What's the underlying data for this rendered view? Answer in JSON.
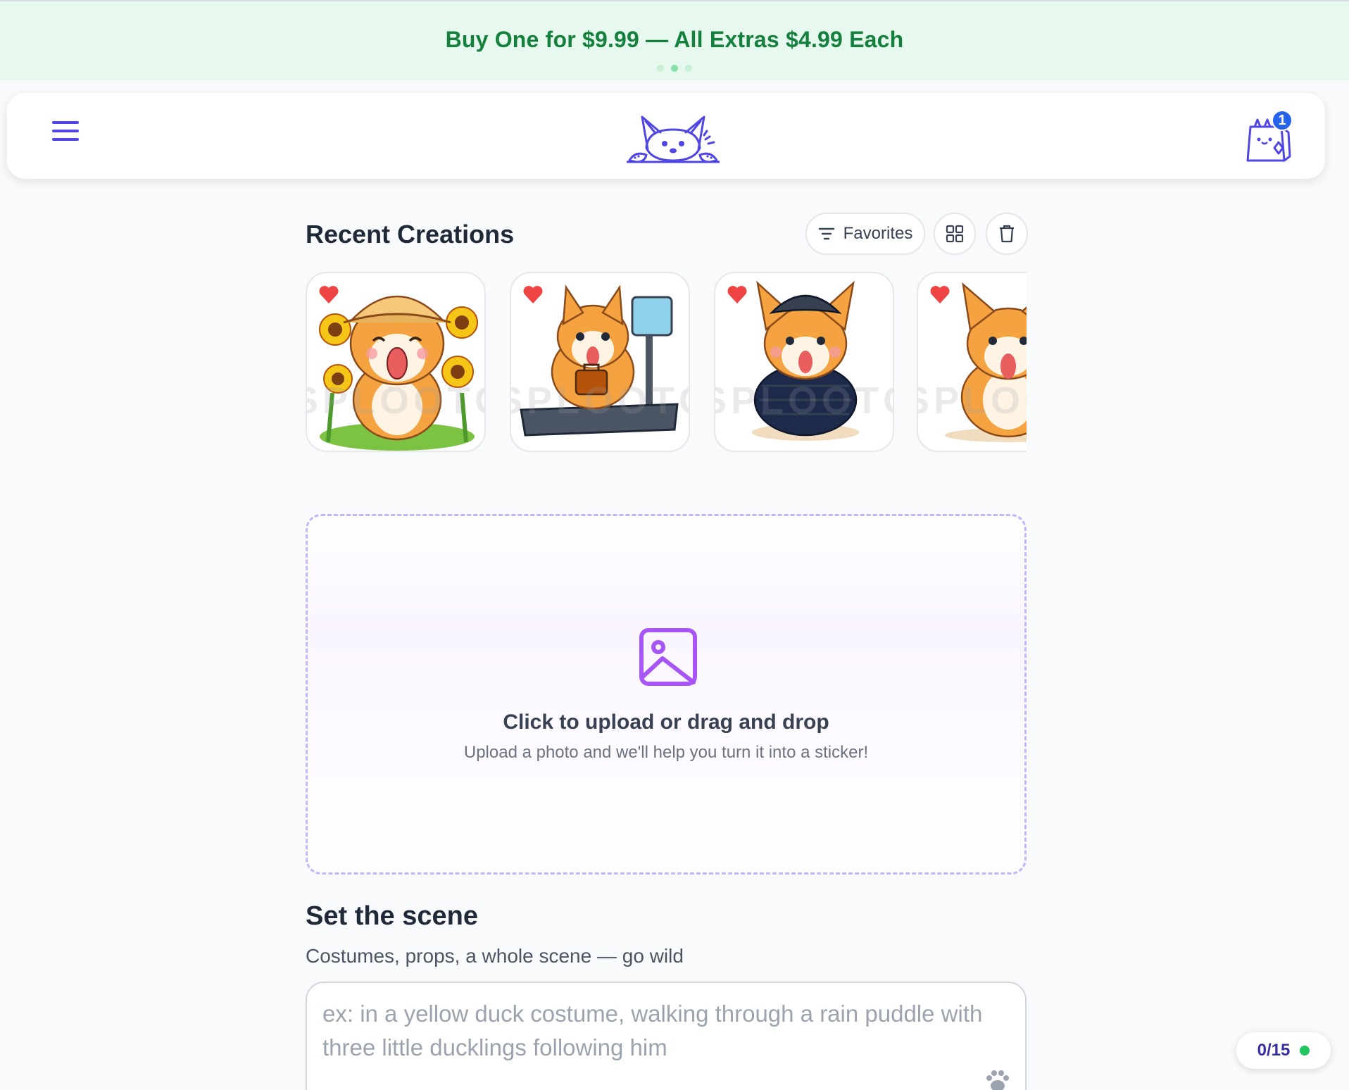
{
  "promo": {
    "text": "Buy One for $9.99 — All Extras $4.99 Each",
    "dots": 3,
    "active_dot": 1
  },
  "header": {
    "menu_icon": "hamburger-menu-icon",
    "logo_icon": "corgi-logo-icon",
    "cart_icon": "shopping-bag-icon",
    "cart_count": "1"
  },
  "recent": {
    "title": "Recent Creations",
    "favorites_label": "Favorites",
    "filter_icon": "filter-icon",
    "grid_icon": "grid-view-icon",
    "trash_icon": "trash-icon",
    "cards": [
      {
        "subject": "corgi in sun hat with sunflowers",
        "favorited": true
      },
      {
        "subject": "corgi on treadmill with briefcase",
        "favorited": true
      },
      {
        "subject": "corgi in flat cap and puffer vest",
        "favorited": true
      },
      {
        "subject": "corgi sitting",
        "favorited": true
      }
    ]
  },
  "upload": {
    "icon": "image-icon",
    "title": "Click to upload or drag and drop",
    "subtitle": "Upload a photo and we'll help you turn it into a sticker!"
  },
  "scene": {
    "title": "Set the scene",
    "subtitle": "Costumes, props, a whole scene — go wild",
    "placeholder": "ex: in a yellow duck costume, walking through a rain puddle with three little ducklings following him",
    "paw_icon": "paw-icon"
  },
  "counter": {
    "text": "0/15",
    "status_color": "#22c55e"
  },
  "colors": {
    "accent": "#4f46e5",
    "promo_text": "#15803d",
    "upload_border": "#c4b5fd",
    "heart": "#ef4444"
  }
}
